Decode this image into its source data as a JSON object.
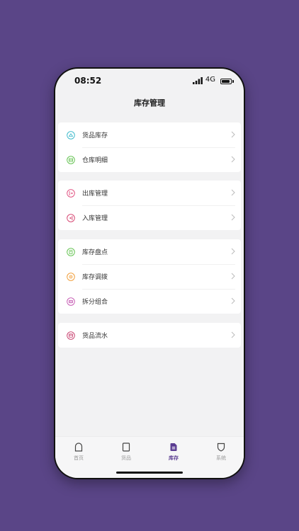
{
  "status": {
    "time": "08:52",
    "network": "4G"
  },
  "header": {
    "title": "库存管理"
  },
  "groups": [
    {
      "items": [
        {
          "label": "货品库存",
          "icon": "goods-stock-icon",
          "color": "#34b7c9"
        },
        {
          "label": "仓库明细",
          "icon": "warehouse-detail-icon",
          "color": "#5bbf47"
        }
      ]
    },
    {
      "items": [
        {
          "label": "出库管理",
          "icon": "outbound-icon",
          "color": "#e0497b"
        },
        {
          "label": "入库管理",
          "icon": "inbound-icon",
          "color": "#d43c6a"
        }
      ]
    },
    {
      "items": [
        {
          "label": "库存盘点",
          "icon": "stocktake-icon",
          "color": "#5bbf47"
        },
        {
          "label": "库存调拨",
          "icon": "transfer-icon",
          "color": "#f0982e"
        },
        {
          "label": "拆分组合",
          "icon": "split-combine-icon",
          "color": "#c455b0"
        }
      ]
    },
    {
      "items": [
        {
          "label": "货品流水",
          "icon": "goods-flow-icon",
          "color": "#c63b6a"
        }
      ]
    }
  ],
  "tabbar": {
    "active": "库存",
    "active_color": "#5b3d92",
    "tabs": [
      {
        "label": "首页",
        "icon": "home-icon"
      },
      {
        "label": "货品",
        "icon": "goods-icon"
      },
      {
        "label": "库存",
        "icon": "inventory-icon"
      },
      {
        "label": "系统",
        "icon": "system-shield-icon"
      }
    ]
  }
}
